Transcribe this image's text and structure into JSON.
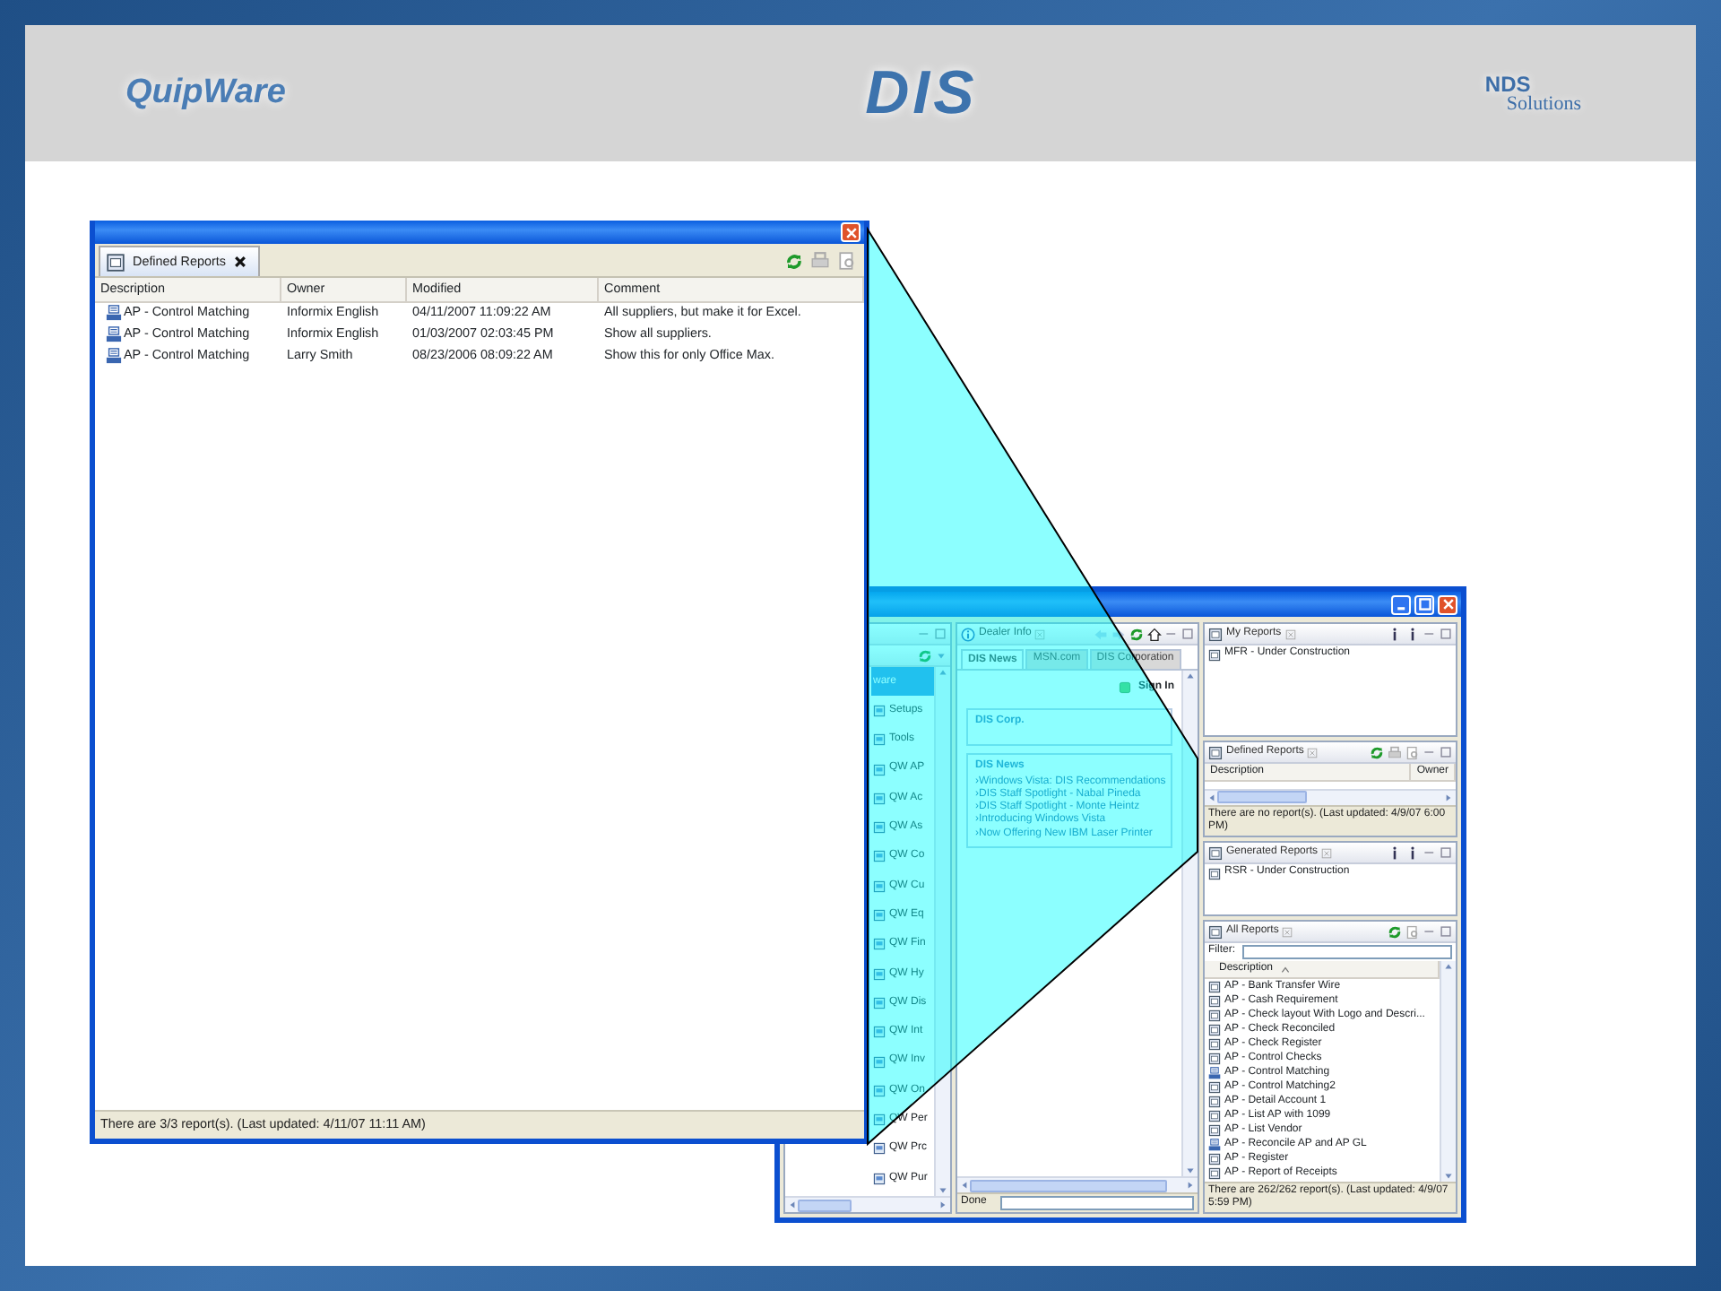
{
  "header": {
    "logos": [
      {
        "kind": "quipware",
        "text": "QuipWare"
      },
      {
        "kind": "dis",
        "text": "DIS"
      },
      {
        "kind": "nds",
        "text": "NDS",
        "subtext": "Solutions"
      }
    ]
  },
  "popup": {
    "tab": {
      "label": "Defined Reports",
      "selected": true
    },
    "columns": [
      "Description",
      "Owner",
      "Modified",
      "Comment"
    ],
    "rows": [
      {
        "description": "AP - Control Matching",
        "owner": "Informix English",
        "modified": "04/11/2007 11:09:22 AM",
        "comment": "All suppliers, but make it for Excel."
      },
      {
        "description": "AP - Control Matching",
        "owner": "Informix English",
        "modified": "01/03/2007 02:03:45 PM",
        "comment": "Show all suppliers."
      },
      {
        "description": "AP - Control Matching",
        "owner": "Larry Smith",
        "modified": "08/23/2006 08:09:22 AM",
        "comment": "Show this for only Office Max."
      }
    ],
    "status": "There are 3/3 report(s).  (Last updated: 4/11/07 11:11 AM)"
  },
  "app_window": {
    "left_panel": {
      "items": [
        {
          "label": "ware",
          "selected": true
        },
        {
          "label": "Setups",
          "selected": false
        },
        {
          "label": "Tools",
          "selected": false
        },
        {
          "label": "QW AP",
          "selected": false
        },
        {
          "label": "QW Ac",
          "selected": false
        },
        {
          "label": "QW As",
          "selected": false
        },
        {
          "label": "QW Co",
          "selected": false
        },
        {
          "label": "QW Cu",
          "selected": false
        },
        {
          "label": "QW Eq",
          "selected": false
        },
        {
          "label": "QW Fin",
          "selected": false
        },
        {
          "label": "QW Hy",
          "selected": false
        },
        {
          "label": "QW Dis",
          "selected": false
        },
        {
          "label": "QW Int",
          "selected": false
        },
        {
          "label": "QW Inv",
          "selected": false
        },
        {
          "label": "QW On",
          "selected": false
        },
        {
          "label": "QW Per",
          "selected": false
        },
        {
          "label": "QW Prc",
          "selected": false
        },
        {
          "label": "QW Pur",
          "selected": false
        }
      ]
    },
    "dealer_info": {
      "title": "Dealer Info",
      "tabs": [
        {
          "label": "DIS News",
          "selected": true
        },
        {
          "label": "MSN.com",
          "selected": false
        },
        {
          "label": "DIS Corporation",
          "selected": false
        }
      ],
      "sign_in": "Sign In",
      "sections": [
        {
          "title": "DIS Corp."
        },
        {
          "title": "DIS News",
          "links": [
            "›Windows Vista: DIS Recommendations",
            "›DIS Staff Spotlight - Nabal Pineda",
            "›DIS Staff Spotlight - Monte Heintz",
            "›Introducing Windows Vista",
            "›Now Offering New IBM Laser Printer"
          ]
        }
      ],
      "status": "Done"
    },
    "my_reports": {
      "title": "My Reports",
      "items": [
        "MFR - Under Construction"
      ]
    },
    "defined_reports": {
      "title": "Defined Reports",
      "columns": [
        "Description",
        "Owner"
      ],
      "status": "There are no report(s).  (Last updated: 4/9/07 6:00 PM)"
    },
    "generated_reports": {
      "title": "Generated Reports",
      "items": [
        "RSR - Under Construction"
      ]
    },
    "all_reports": {
      "title": "All Reports",
      "filter_label": "Filter:",
      "column": "Description",
      "items": [
        {
          "label": "AP - Bank Transfer Wire",
          "kind": "report"
        },
        {
          "label": "AP - Cash Requirement",
          "kind": "report"
        },
        {
          "label": "AP - Check layout With Logo and Descri...",
          "kind": "report"
        },
        {
          "label": "AP - Check Reconciled",
          "kind": "report"
        },
        {
          "label": "AP - Check Register",
          "kind": "report"
        },
        {
          "label": "AP - Control Checks",
          "kind": "report"
        },
        {
          "label": "AP - Control Matching",
          "kind": "dis"
        },
        {
          "label": "AP - Control Matching2",
          "kind": "report"
        },
        {
          "label": "AP - Detail Account 1",
          "kind": "report"
        },
        {
          "label": "AP - List AP with 1099",
          "kind": "report"
        },
        {
          "label": "AP - List Vendor",
          "kind": "report"
        },
        {
          "label": "AP - Reconcile AP and AP GL",
          "kind": "dis"
        },
        {
          "label": "AP - Register",
          "kind": "report"
        },
        {
          "label": "AP - Report of Receipts",
          "kind": "report"
        }
      ],
      "status": "There are 262/262 report(s).  (Last updated: 4/9/07 5:59 PM)"
    }
  }
}
